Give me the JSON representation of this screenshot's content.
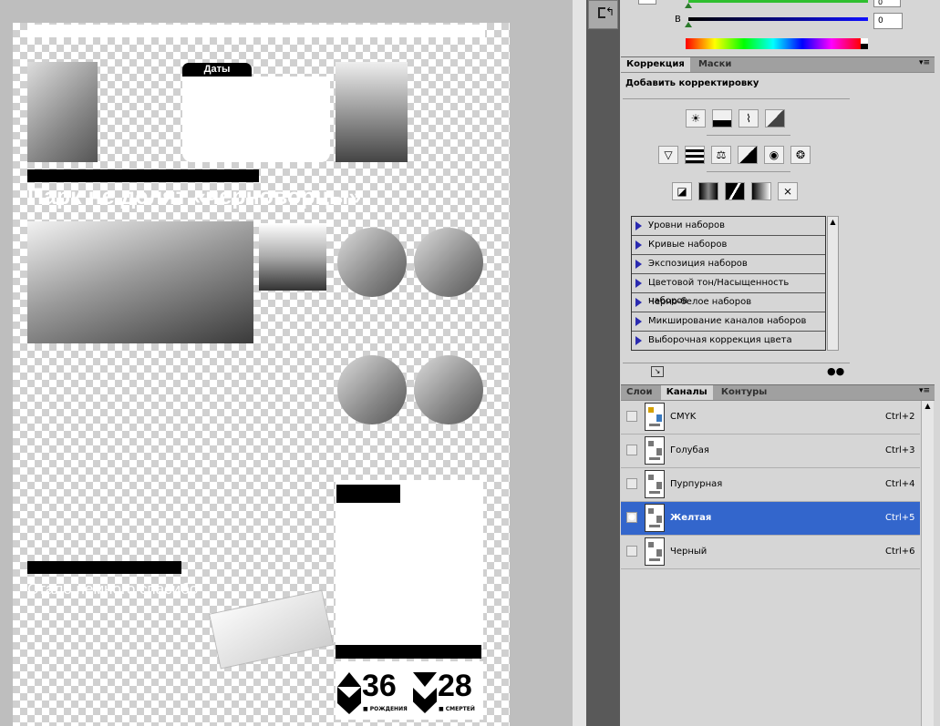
{
  "colors": {
    "selection": "#3366cc",
    "panel_bg": "#d6d6d6",
    "canvas_bg": "#bebebe"
  },
  "document": {
    "dates_label": "Даты",
    "headline": "Парк не делят «черноворцы»",
    "subheadline": "Стало немного спасибо",
    "stats": [
      {
        "number": "36",
        "caption": "■ РОЖДЕНИЯ"
      },
      {
        "number": "28",
        "caption": "■ СМЕРТЕЙ"
      }
    ]
  },
  "color_panel": {
    "b_label": "B",
    "c_value": "0",
    "b_value": "0"
  },
  "correction_panel": {
    "tabs": [
      {
        "label": "Коррекция",
        "active": true
      },
      {
        "label": "Маски",
        "active": false
      }
    ],
    "title": "Добавить корректировку",
    "icons_row1": [
      "brightness-icon",
      "levels-icon",
      "curves-icon",
      "exposure-icon"
    ],
    "icons_row2": [
      "vibrance-icon",
      "hue-saturation-icon",
      "color-balance-icon",
      "black-white-icon",
      "photo-filter-icon",
      "channel-mixer-icon"
    ],
    "icons_row3": [
      "invert-icon",
      "posterize-icon",
      "threshold-icon",
      "gradient-map-icon",
      "selective-color-icon"
    ],
    "presets": [
      "Уровни наборов",
      "Кривые наборов",
      "Экспозиция наборов",
      "Цветовой тон/Насыщенность наборов",
      "Черно-белое наборов",
      "Микширование каналов наборов",
      "Выборочная коррекция цвета наборов"
    ]
  },
  "channels_panel": {
    "tabs": [
      {
        "label": "Слои",
        "active": false
      },
      {
        "label": "Каналы",
        "active": true
      },
      {
        "label": "Контуры",
        "active": false
      }
    ],
    "channels": [
      {
        "name": "CMYK",
        "shortcut": "Ctrl+2",
        "visible": false,
        "selected": false
      },
      {
        "name": "Голубая",
        "shortcut": "Ctrl+3",
        "visible": false,
        "selected": false
      },
      {
        "name": "Пурпурная",
        "shortcut": "Ctrl+4",
        "visible": false,
        "selected": false
      },
      {
        "name": "Желтая",
        "shortcut": "Ctrl+5",
        "visible": true,
        "selected": true
      },
      {
        "name": "Черный",
        "shortcut": "Ctrl+6",
        "visible": false,
        "selected": false
      }
    ]
  }
}
